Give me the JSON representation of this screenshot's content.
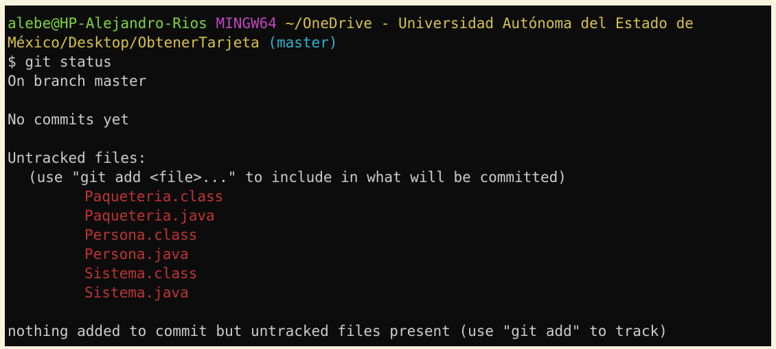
{
  "prompt": {
    "user_host": "alebe@HP-Alejandro-Rios",
    "shell": "MINGW64",
    "path_line1": "~/OneDrive - Universidad Autónoma del Estado de",
    "path_line2": "México/Desktop/ObtenerTarjeta",
    "branch": "(master)",
    "symbol": "$",
    "command": "git status"
  },
  "output": {
    "on_branch": "On branch master",
    "no_commits": "No commits yet",
    "untracked_header": "Untracked files:",
    "hint": "(use \"git add <file>...\" to include in what will be committed)",
    "files": [
      "Paqueteria.class",
      "Paqueteria.java",
      "Persona.class",
      "Persona.java",
      "Sistema.class",
      "Sistema.java"
    ],
    "summary": "nothing added to commit but untracked files present (use \"git add\" to track)"
  },
  "colors": {
    "background": "#0c0c0c",
    "user_host": "#7dd63a",
    "shell": "#c146c1",
    "path": "#d8c24a",
    "branch": "#2eb4cf",
    "untracked_file": "#c03434",
    "text": "#cccccc"
  }
}
